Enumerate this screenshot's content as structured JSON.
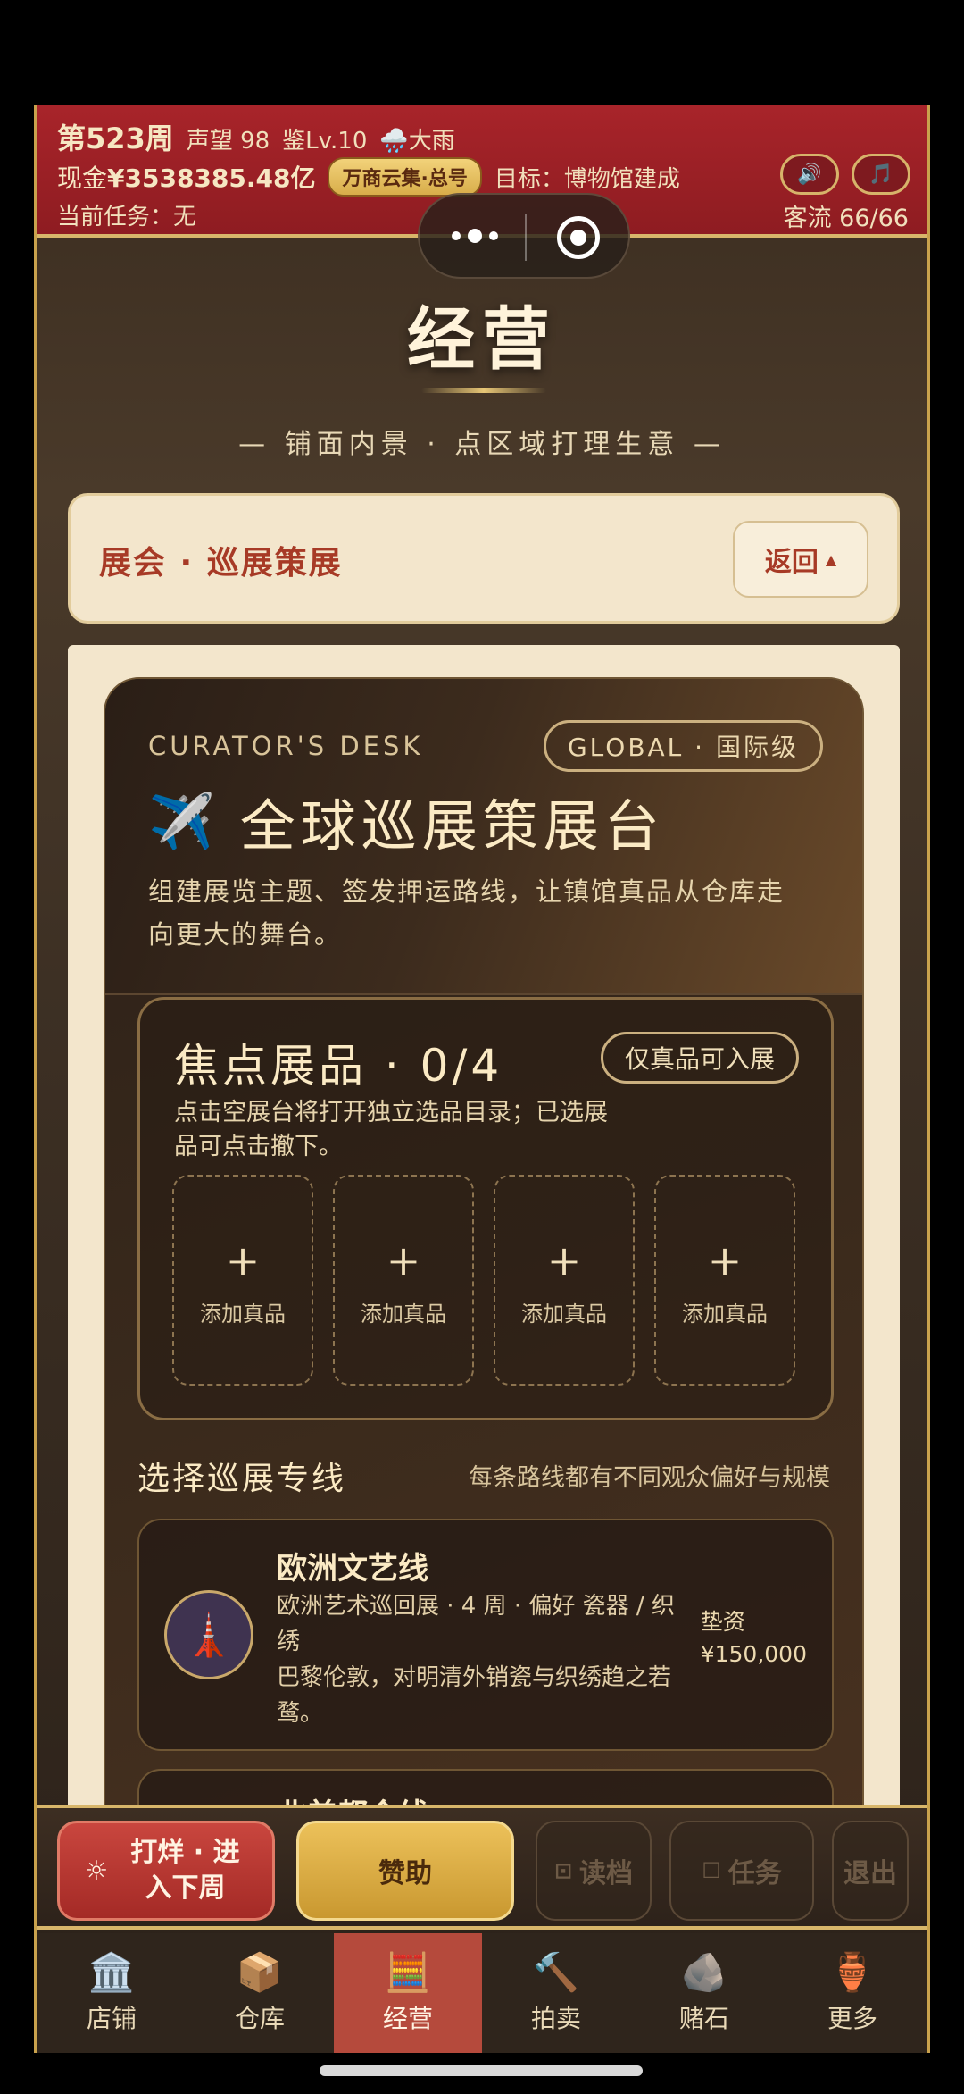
{
  "header": {
    "week": "第523周",
    "reputation": "声望 98",
    "appraisal": "鉴Lv.10",
    "weather": "🌧️大雨",
    "cash_label": "现金",
    "cash_value": "¥3538385.48亿",
    "group_chip": "万商云集·总号",
    "goal": "目标：博物馆建成",
    "task": "当前任务：无",
    "visitors": "客流 66/66",
    "sound_icon": "🔊",
    "music_icon": "🎵"
  },
  "page": {
    "title": "经营",
    "subtitle": "— 铺面内景 · 点区域打理生意 —"
  },
  "section": {
    "label": "展会 · 巡展策展",
    "back_label": "返回",
    "back_arrow": "▲"
  },
  "desk": {
    "eyebrow": "CURATOR'S DESK",
    "level_pill": "GLOBAL · 国际级",
    "icon": "✈️",
    "title": "全球巡展策展台",
    "description": "组建展览主题、签发押运路线，让镇馆真品从仓库走向更大的舞台。"
  },
  "focus": {
    "title": "焦点展品 · 0/4",
    "pill": "仅真品可入展",
    "description": "点击空展台将打开独立选品目录；已选展品可点击撤下。",
    "slots": [
      {
        "plus": "+",
        "label": "添加真品"
      },
      {
        "plus": "+",
        "label": "添加真品"
      },
      {
        "plus": "+",
        "label": "添加真品"
      },
      {
        "plus": "+",
        "label": "添加真品"
      }
    ]
  },
  "routes": {
    "heading": "选择巡展专线",
    "note": "每条路线都有不同观众偏好与规模",
    "items": [
      {
        "icon": "🗼",
        "name": "欧洲文艺线",
        "line1": "欧洲艺术巡回展 · 4 周 · 偏好 瓷器 / 织绣",
        "line2": "巴黎伦敦，对明清外销瓷与织绣趋之若鹜。",
        "cost_label": "垫资",
        "cost_value": "¥150,000"
      },
      {
        "name": "北美都会线"
      }
    ]
  },
  "actions": {
    "next_icon": "☼",
    "next_label": "打烊 · 进入下周",
    "sponsor": "赞助",
    "load": "读档",
    "load_icon": "⊡",
    "task": "任务",
    "task_icon": "☐",
    "exit": "退出"
  },
  "tabs": [
    {
      "icon": "🏛️",
      "label": "店铺",
      "active": false
    },
    {
      "icon": "📦",
      "label": "仓库",
      "active": false
    },
    {
      "icon": "🧮",
      "label": "经营",
      "active": true
    },
    {
      "icon": "🔨",
      "label": "拍卖",
      "active": false
    },
    {
      "icon": "🪨",
      "label": "赌石",
      "active": false
    },
    {
      "icon": "🏺",
      "label": "更多",
      "active": false
    }
  ]
}
